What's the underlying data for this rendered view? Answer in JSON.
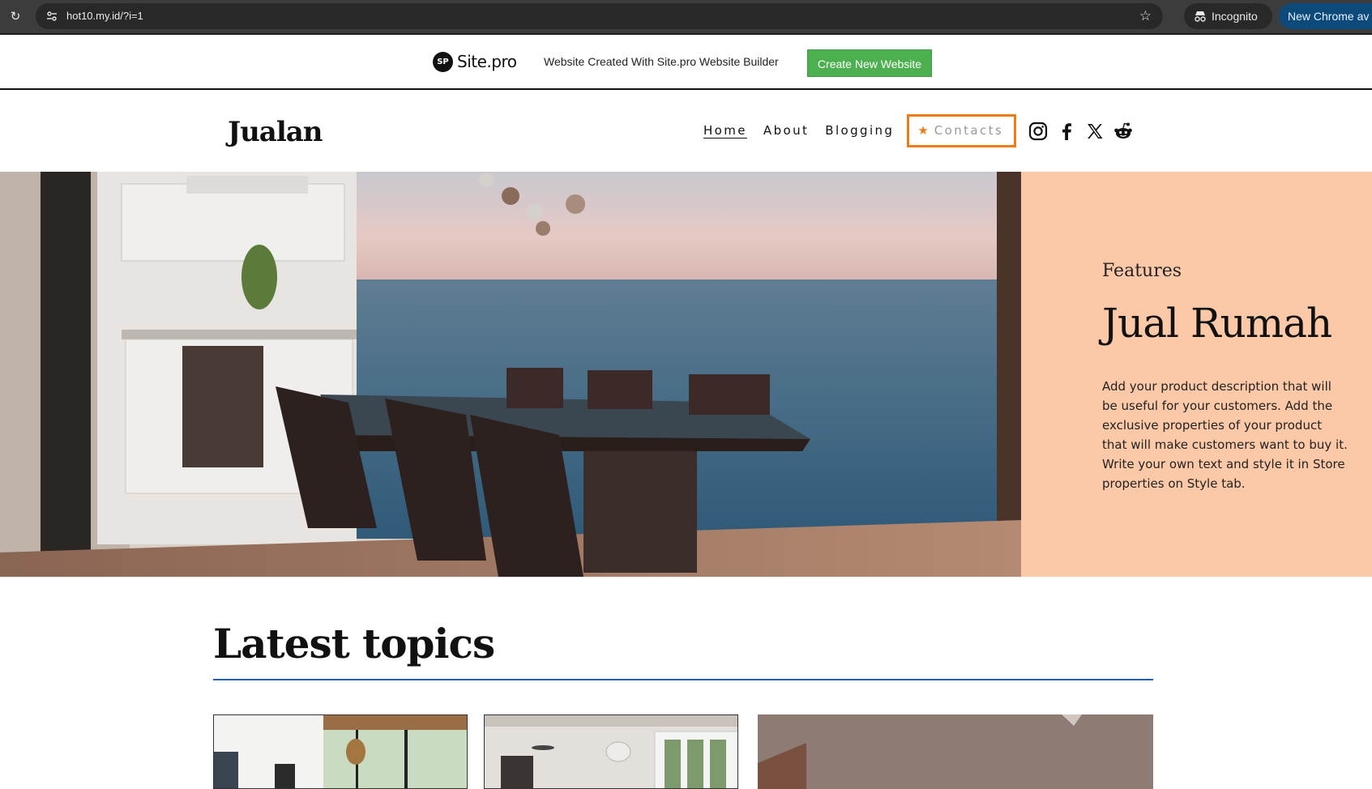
{
  "browser": {
    "url": "hot10.my.id/?i=1",
    "incognito_label": "Incognito",
    "promo_label": "New Chrome av"
  },
  "banner": {
    "logo_badge": "SP",
    "logo_name": "Site.pro",
    "text": "Website Created With Site.pro Website Builder",
    "cta": "Create New Website"
  },
  "header": {
    "brand": "Jualan",
    "nav": [
      "Home",
      "About",
      "Blogging",
      "Contacts"
    ],
    "social_icons": [
      "instagram-icon",
      "facebook-icon",
      "x-icon",
      "reddit-icon"
    ]
  },
  "hero": {
    "eyebrow": "Features",
    "title": "Jual Rumah",
    "description": "Add your product description that will be useful for your customers. Add the exclusive properties of your product that will make customers want to buy it. Write your own text and style it in Store properties on Style tab."
  },
  "topics": {
    "title": "Latest topics"
  },
  "colors": {
    "accent_peach": "#fcc9a8",
    "highlight_orange": "#f07a17",
    "cta_green": "#4cb050",
    "rule_blue": "#1f5fbf"
  }
}
